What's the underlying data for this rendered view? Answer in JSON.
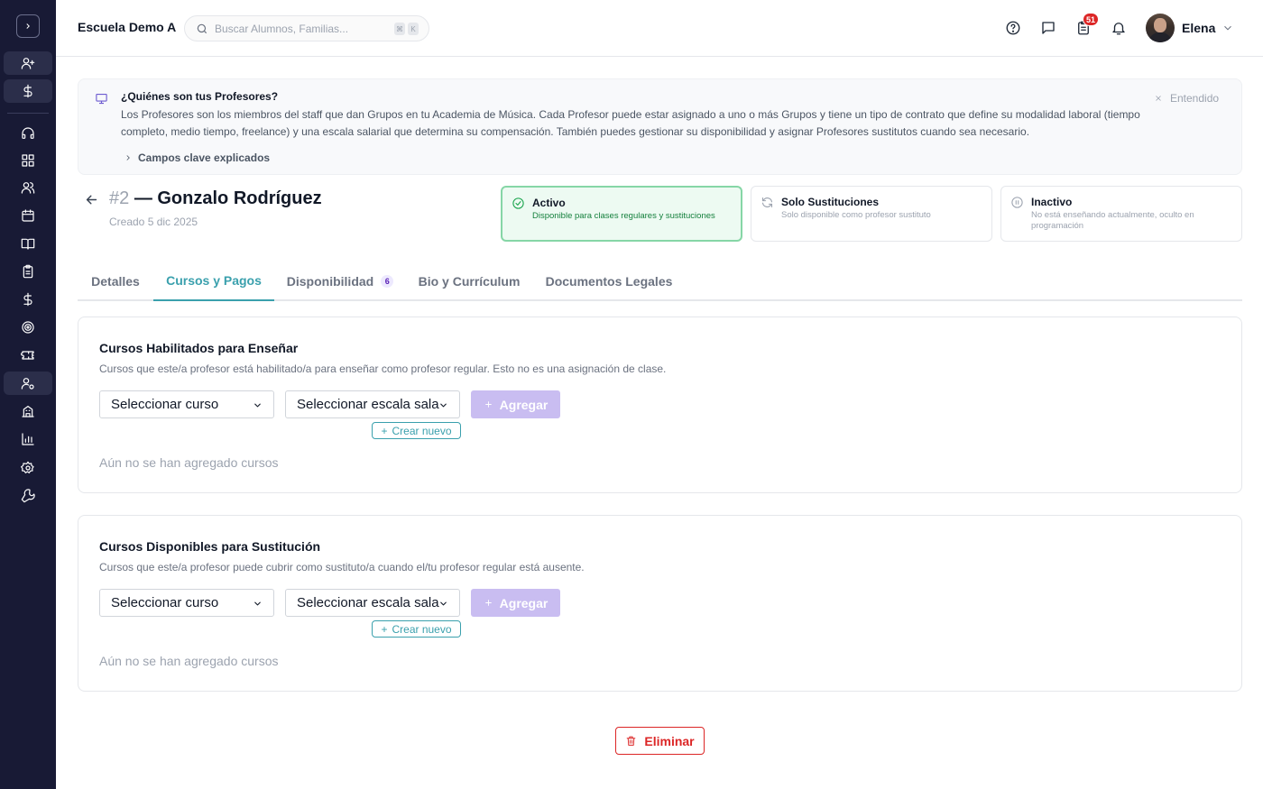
{
  "header": {
    "school_name": "Escuela Demo A",
    "search_placeholder": "Buscar Alumnos, Familias...",
    "shortcut_keys": [
      "⌘",
      "K"
    ],
    "notification_count": "51",
    "user_name": "Elena"
  },
  "sidebar": {
    "items": [
      "add-user",
      "dollar",
      "support",
      "dashboard",
      "users",
      "calendar",
      "book",
      "clipboard",
      "payments",
      "target",
      "ticket",
      "teachers",
      "building",
      "reports",
      "settings",
      "tools"
    ]
  },
  "banner": {
    "title": "¿Quiénes son tus Profesores?",
    "text": "Los Profesores son los miembros del staff que dan Grupos en tu Academia de Música. Cada Profesor puede estar asignado a uno o más Grupos y tiene un tipo de contrato que define su modalidad laboral (tiempo completo, medio tiempo, freelance) y una escala salarial que determina su compensación. También puedes gestionar su disponibilidad y asignar Profesores sustitutos cuando sea necesario.",
    "link": "Campos clave explicados",
    "dismiss": "Entendido"
  },
  "teacher": {
    "number": "#2",
    "name": "— Gonzalo Rodríguez",
    "created": "Creado 5 dic 2025"
  },
  "statuses": [
    {
      "title": "Activo",
      "description": "Disponible para clases regulares y sustituciones",
      "selected": true
    },
    {
      "title": "Solo Sustituciones",
      "description": "Solo disponible como profesor sustituto",
      "selected": false
    },
    {
      "title": "Inactivo",
      "description": "No está enseñando actualmente, oculto en programación",
      "selected": false
    }
  ],
  "tabs": [
    {
      "label": "Detalles"
    },
    {
      "label": "Cursos y Pagos",
      "active": true
    },
    {
      "label": "Disponibilidad",
      "count": "6"
    },
    {
      "label": "Bio y Currículum"
    },
    {
      "label": "Documentos Legales"
    }
  ],
  "sections": [
    {
      "title": "Cursos Habilitados para Enseñar",
      "subtitle": "Cursos que este/a profesor está habilitado/a para enseñar como profesor regular. Esto no es una asignación de clase.",
      "course_select": "Seleccionar curso",
      "scale_select": "Seleccionar escala sala",
      "add_label": "Agregar",
      "create_label": "Crear nuevo",
      "empty_text": "Aún no se han agregado cursos"
    },
    {
      "title": "Cursos Disponibles para Sustitución",
      "subtitle": "Cursos que este/a profesor puede cubrir como sustituto/a cuando el/tu profesor regular está ausente.",
      "course_select": "Seleccionar curso",
      "scale_select": "Seleccionar escala sala",
      "add_label": "Agregar",
      "create_label": "Crear nuevo",
      "empty_text": "Aún no se han agregado cursos"
    }
  ],
  "actions": {
    "delete_label": "Eliminar"
  },
  "colors": {
    "sidebar_bg": "#181a35",
    "accent_teal": "#3aa0ad",
    "active_green": "#86d6a6",
    "add_button": "#c9bdf1",
    "danger": "#dc2626"
  }
}
